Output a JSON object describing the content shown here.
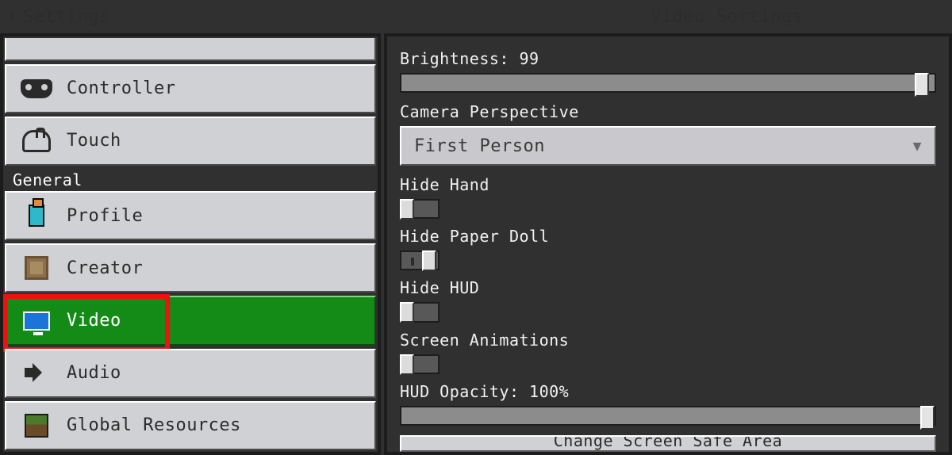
{
  "header": {
    "back_label": "Settings",
    "panel_title": "Video Settings"
  },
  "sidebar": {
    "top_items": [
      {
        "label": "Controller",
        "icon": "controller-icon"
      },
      {
        "label": "Touch",
        "icon": "touch-icon"
      }
    ],
    "group_label": "General",
    "general_items": [
      {
        "label": "Profile",
        "icon": "profile-icon"
      },
      {
        "label": "Creator",
        "icon": "creator-icon"
      },
      {
        "label": "Video",
        "icon": "video-icon",
        "active": true,
        "highlighted": true
      },
      {
        "label": "Audio",
        "icon": "audio-icon"
      },
      {
        "label": "Global Resources",
        "icon": "global-resources-icon"
      }
    ]
  },
  "settings": {
    "brightness": {
      "label": "Brightness: 99",
      "value": 99,
      "max": 100
    },
    "camera": {
      "label": "Camera Perspective",
      "selected": "First Person"
    },
    "hide_hand": {
      "label": "Hide Hand",
      "on": false
    },
    "hide_paper_doll": {
      "label": "Hide Paper Doll",
      "on": true
    },
    "hide_hud": {
      "label": "Hide HUD",
      "on": false
    },
    "screen_animations": {
      "label": "Screen Animations",
      "on": false
    },
    "hud_opacity": {
      "label": "HUD Opacity: 100%",
      "value": 100,
      "max": 100
    },
    "bottom_button": "Change Screen Safe Area"
  }
}
